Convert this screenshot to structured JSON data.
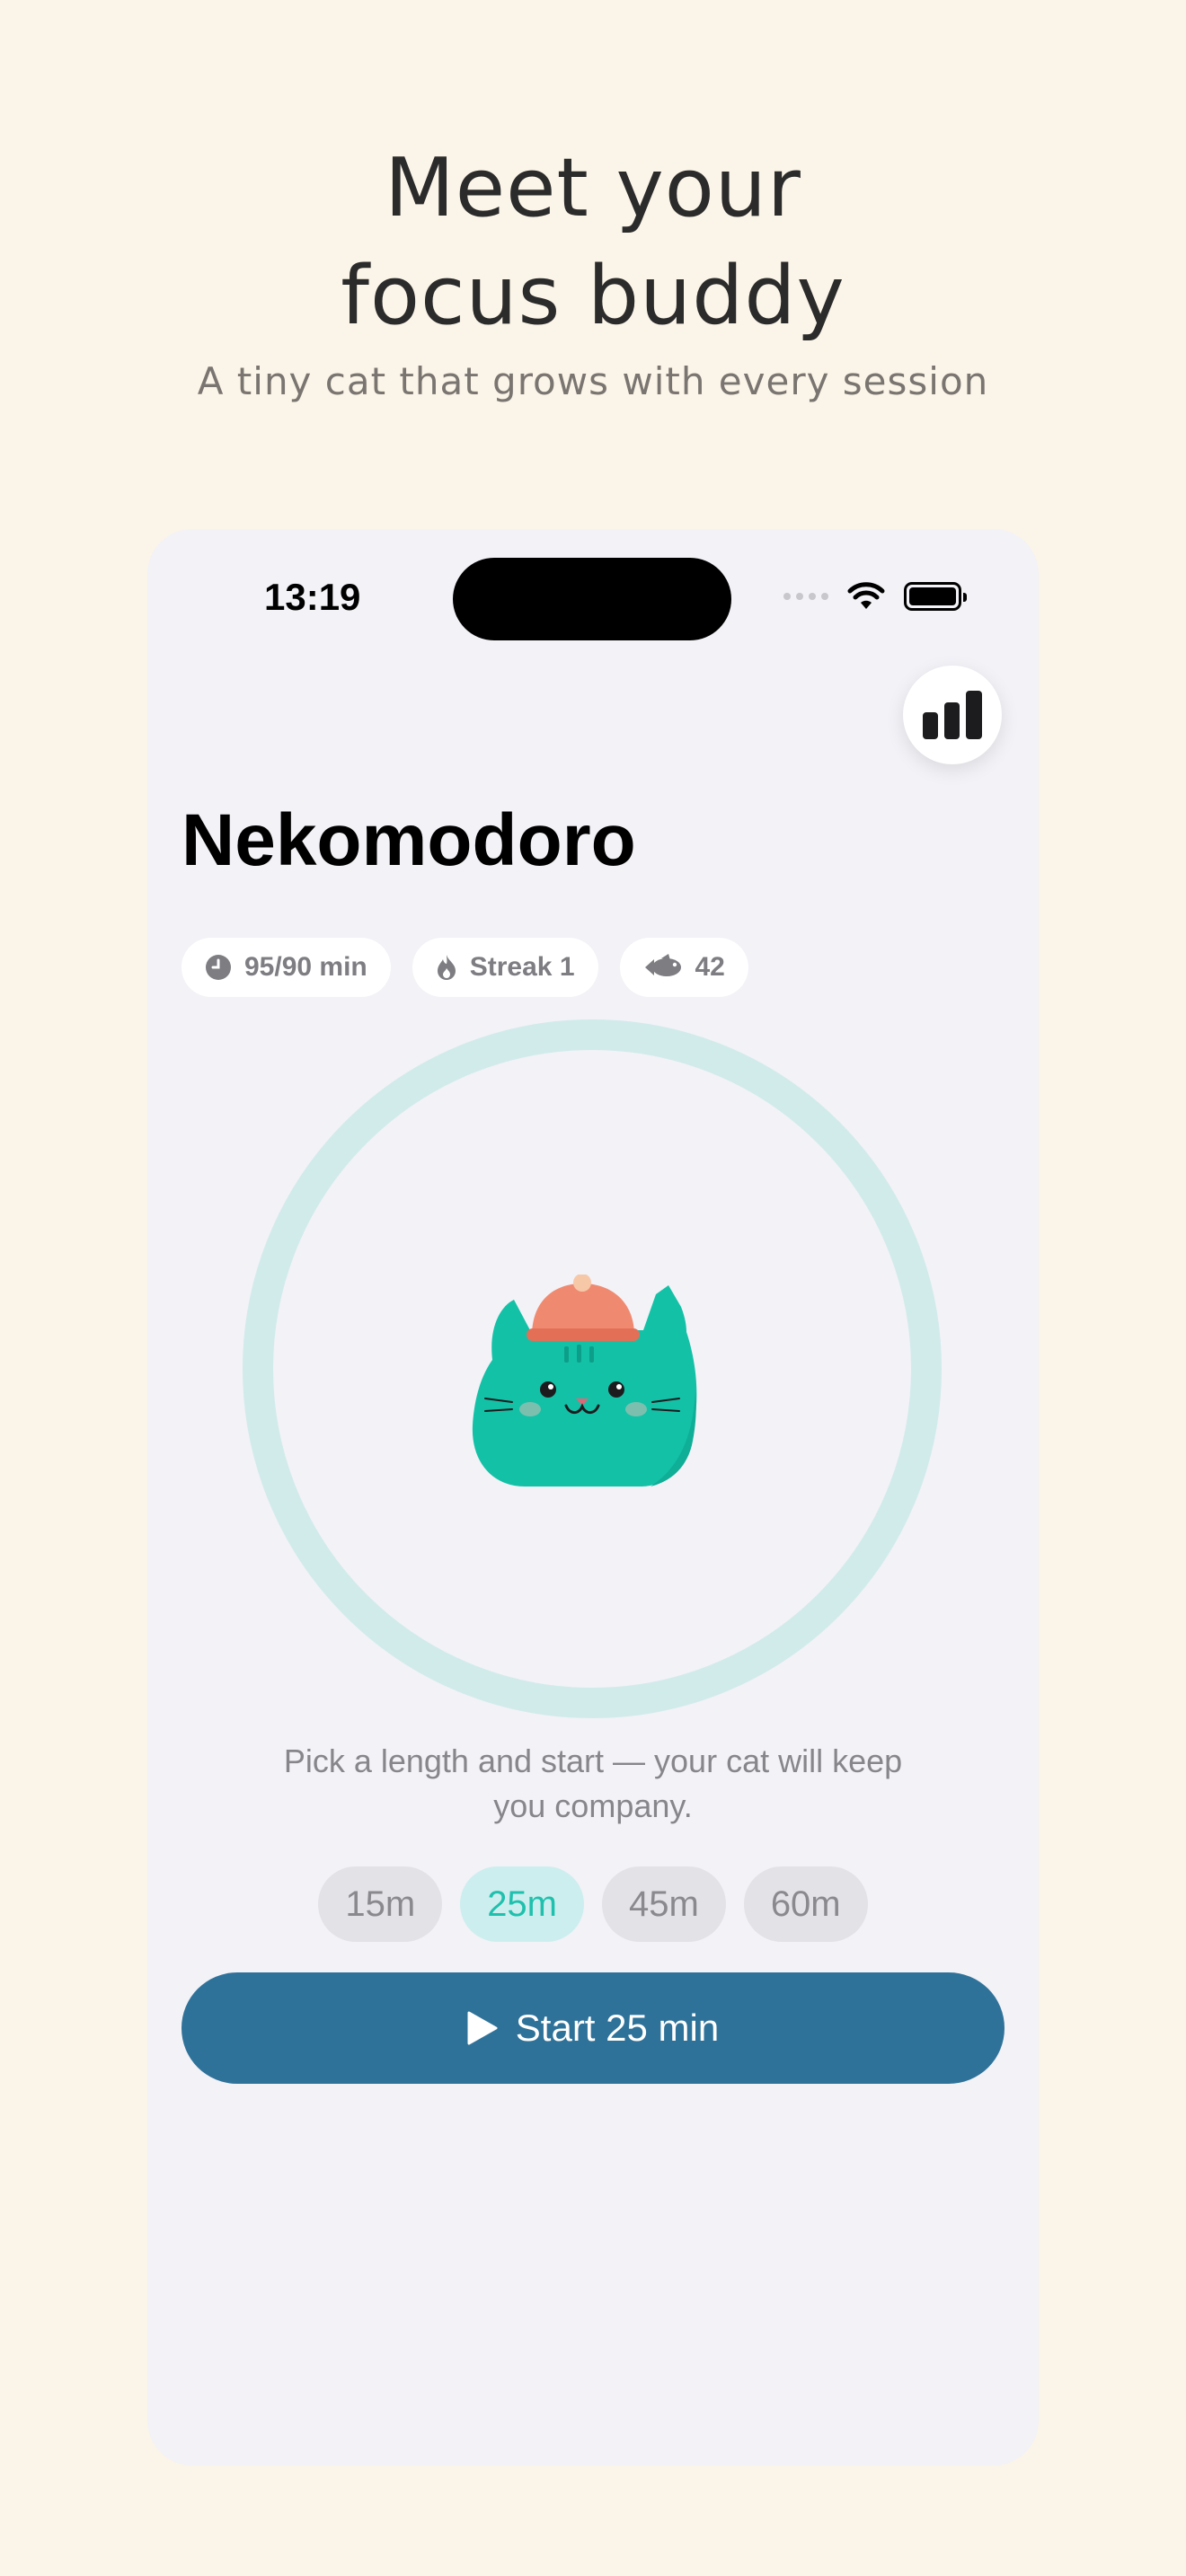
{
  "promo": {
    "title_line1": "Meet your",
    "title_line2": "focus buddy",
    "subtitle": "A tiny cat that grows with every session"
  },
  "status_bar": {
    "time": "13:19",
    "icons": [
      "signal-dots-icon",
      "wifi-icon",
      "battery-icon"
    ]
  },
  "header": {
    "title": "Nekomodoro",
    "stats_button_icon": "bar-chart-icon"
  },
  "chips": [
    {
      "icon": "clock-icon",
      "label": "95/90 min"
    },
    {
      "icon": "flame-icon",
      "label": "Streak 1"
    },
    {
      "icon": "fish-icon",
      "label": "42"
    }
  ],
  "timer": {
    "progress": 0,
    "ring_color": "#d1ebeb",
    "cat_color": "#13c1a7",
    "hat_color": "#ef8a70"
  },
  "hint": "Pick a length and start — your cat will keep you company.",
  "durations": [
    {
      "label": "15m",
      "selected": false
    },
    {
      "label": "25m",
      "selected": true
    },
    {
      "label": "45m",
      "selected": false
    },
    {
      "label": "60m",
      "selected": false
    }
  ],
  "start_button": {
    "label": "Start 25 min",
    "icon": "play-icon",
    "color": "#2f7299"
  },
  "colors": {
    "background": "#fbf4e8",
    "phone_bg": "#f2f2f7",
    "accent": "#1fc0ad"
  }
}
